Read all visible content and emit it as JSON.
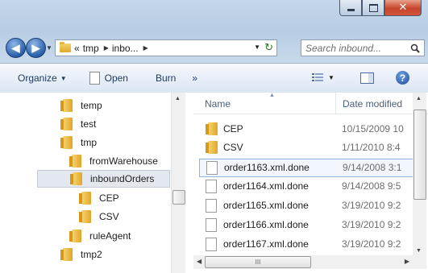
{
  "window": {
    "buttons": {
      "minimize": "minimize",
      "maximize": "maximize",
      "close": "close"
    }
  },
  "navbar": {
    "back_icon": "back-arrow-icon",
    "forward_icon": "forward-arrow-icon",
    "breadcrumb": [
      "«",
      "tmp",
      "inbo..."
    ],
    "search_placeholder": "Search inbound..."
  },
  "toolbar": {
    "organize_label": "Organize",
    "open_label": "Open",
    "burn_label": "Burn",
    "more_label": "»"
  },
  "tree": {
    "items": [
      {
        "label": "temp",
        "level": 0
      },
      {
        "label": "test",
        "level": 0
      },
      {
        "label": "tmp",
        "level": 0
      },
      {
        "label": "fromWarehouse",
        "level": 1
      },
      {
        "label": "inboundOrders",
        "level": 1,
        "selected": true
      },
      {
        "label": "CEP",
        "level": 2
      },
      {
        "label": "CSV",
        "level": 2
      },
      {
        "label": "ruleAgent",
        "level": 1
      },
      {
        "label": "tmp2",
        "level": 0
      }
    ]
  },
  "files": {
    "columns": {
      "name": "Name",
      "date": "Date modified"
    },
    "rows": [
      {
        "name": "CEP",
        "date": "10/15/2009 10",
        "type": "folder"
      },
      {
        "name": "CSV",
        "date": "1/11/2010 8:4",
        "type": "folder"
      },
      {
        "name": "order1163.xml.done",
        "date": "9/14/2008 3:1",
        "type": "file",
        "selected": true
      },
      {
        "name": "order1164.xml.done",
        "date": "9/14/2008 9:5",
        "type": "file"
      },
      {
        "name": "order1165.xml.done",
        "date": "3/19/2010 9:2",
        "type": "file"
      },
      {
        "name": "order1166.xml.done",
        "date": "3/19/2010 9:2",
        "type": "file"
      },
      {
        "name": "order1167.xml.done",
        "date": "3/19/2010 9:2",
        "type": "file"
      }
    ]
  },
  "scroll": {
    "h_thumb_glyph": "III"
  }
}
